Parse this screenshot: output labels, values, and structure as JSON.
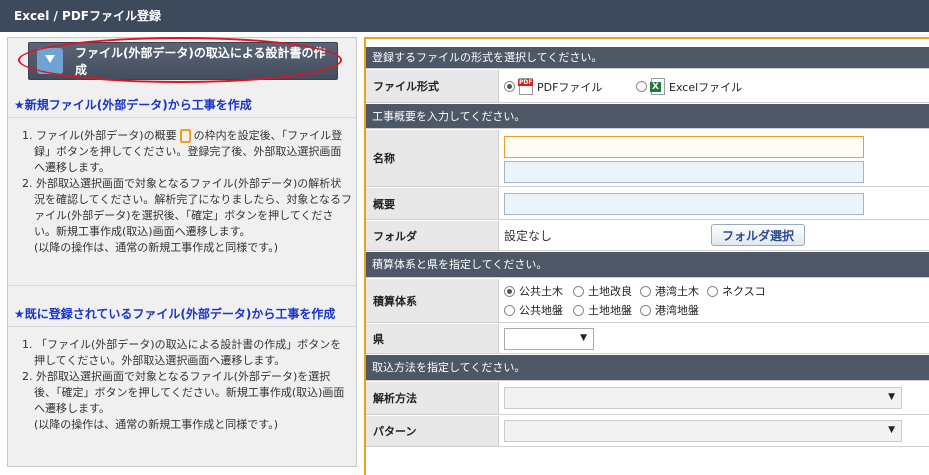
{
  "window": {
    "title": "Excel / PDFファイル登録"
  },
  "left_panel": {
    "import_button_label": "ファイル(外部データ)の取込による設計書の作成",
    "section1": {
      "heading": "★新規ファイル(外部データ)から工事を作成",
      "item1_pre": "1. ファイル(外部データ)の概要",
      "item1_post": "の枠内を設定後、「ファイル登録」ボタンを押してください。登録完了後、外部取込選択画面へ遷移します。",
      "item2": "2. 外部取込選択画面で対象となるファイル(外部データ)の解析状況を確認してください。解析完了になりましたら、対象となるファイル(外部データ)を選択後、「確定」ボタンを押してください。新規工事作成(取込)画面へ遷移します。",
      "note": "(以降の操作は、通常の新規工事作成と同様です。)"
    },
    "section2": {
      "heading": "★既に登録されているファイル(外部データ)から工事を作成",
      "item1": "1. 「ファイル(外部データ)の取込による設計書の作成」ボタンを押してください。外部取込選択画面へ遷移します。",
      "item2": "2. 外部取込選択画面で対象となるファイル(外部データ)を選択後、「確定」ボタンを押してください。新規工事作成(取込)画面へ遷移します。",
      "note": "(以降の操作は、通常の新規工事作成と同様です。)"
    }
  },
  "form": {
    "format_section": {
      "header": "登録するファイルの形式を選択してください。",
      "label": "ファイル形式",
      "options": [
        "PDFファイル",
        "Excelファイル"
      ],
      "selected": "PDFファイル"
    },
    "overview_section": {
      "header": "工事概要を入力してください。",
      "name_label": "名称",
      "name_value": "",
      "name_value2": "",
      "summary_label": "概要",
      "summary_value": "",
      "folder_label": "フォルダ",
      "folder_value": "設定なし",
      "folder_button": "フォルダ選択"
    },
    "estimate_section": {
      "header": "積算体系と県を指定してください。",
      "system_label": "積算体系",
      "options": [
        "公共土木",
        "土地改良",
        "港湾土木",
        "ネクスコ",
        "公共地盤",
        "土地地盤",
        "港湾地盤"
      ],
      "selected": "公共土木",
      "pref_label": "県",
      "pref_value": ""
    },
    "import_section": {
      "header": "取込方法を指定してください。",
      "method_label": "解析方法",
      "method_value": "",
      "pattern_label": "パターン",
      "pattern_value": ""
    }
  }
}
